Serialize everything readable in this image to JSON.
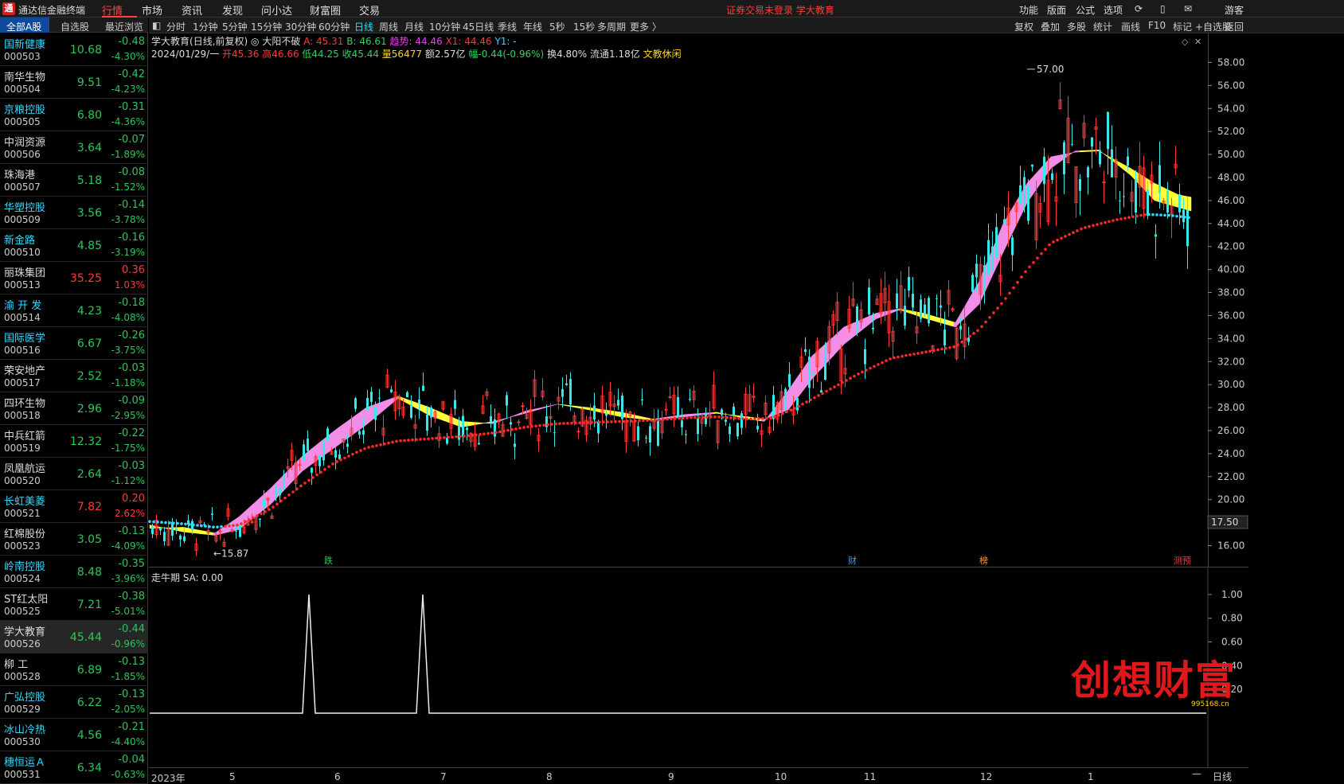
{
  "app": {
    "logo": "通",
    "title": "通达信金融终端",
    "menus": [
      "行情",
      "市场",
      "资讯",
      "发现",
      "问小达",
      "财富圈",
      "交易"
    ],
    "active_menu": "行情",
    "login_warning": "证券交易未登录  学大教育",
    "tools": [
      "功能",
      "版面",
      "公式",
      "选项"
    ],
    "guest": "游客"
  },
  "left_panel": {
    "tabs": [
      "全部A股",
      "自选股",
      "最近浏览"
    ],
    "stocks": [
      {
        "name": "国新健康",
        "code": "000503",
        "price": "10.68",
        "chg": "-0.48",
        "pct": "-4.30%",
        "dir": "down",
        "cyan": true
      },
      {
        "name": "南华生物",
        "code": "000504",
        "price": "9.51",
        "chg": "-0.42",
        "pct": "-4.23%",
        "dir": "down",
        "cyan": false
      },
      {
        "name": "京粮控股",
        "code": "000505",
        "price": "6.80",
        "chg": "-0.31",
        "pct": "-4.36%",
        "dir": "down",
        "cyan": true
      },
      {
        "name": "中润资源",
        "code": "000506",
        "price": "3.64",
        "chg": "-0.07",
        "pct": "-1.89%",
        "dir": "down",
        "cyan": false
      },
      {
        "name": "珠海港",
        "code": "000507",
        "price": "5.18",
        "chg": "-0.08",
        "pct": "-1.52%",
        "dir": "down",
        "cyan": false
      },
      {
        "name": "华塑控股",
        "code": "000509",
        "price": "3.56",
        "chg": "-0.14",
        "pct": "-3.78%",
        "dir": "down",
        "cyan": true
      },
      {
        "name": "新金路",
        "code": "000510",
        "price": "4.85",
        "chg": "-0.16",
        "pct": "-3.19%",
        "dir": "down",
        "cyan": true
      },
      {
        "name": "丽珠集团",
        "code": "000513",
        "price": "35.25",
        "chg": "0.36",
        "pct": "1.03%",
        "dir": "up",
        "cyan": false
      },
      {
        "name": "渝 开 发",
        "code": "000514",
        "price": "4.23",
        "chg": "-0.18",
        "pct": "-4.08%",
        "dir": "down",
        "cyan": true
      },
      {
        "name": "国际医学",
        "code": "000516",
        "price": "6.67",
        "chg": "-0.26",
        "pct": "-3.75%",
        "dir": "down",
        "cyan": true
      },
      {
        "name": "荣安地产",
        "code": "000517",
        "price": "2.52",
        "chg": "-0.03",
        "pct": "-1.18%",
        "dir": "down",
        "cyan": false
      },
      {
        "name": "四环生物",
        "code": "000518",
        "price": "2.96",
        "chg": "-0.09",
        "pct": "-2.95%",
        "dir": "down",
        "cyan": false
      },
      {
        "name": "中兵红箭",
        "code": "000519",
        "price": "12.32",
        "chg": "-0.22",
        "pct": "-1.75%",
        "dir": "down",
        "cyan": false
      },
      {
        "name": "凤凰航运",
        "code": "000520",
        "price": "2.64",
        "chg": "-0.03",
        "pct": "-1.12%",
        "dir": "down",
        "cyan": false
      },
      {
        "name": "长虹美菱",
        "code": "000521",
        "price": "7.82",
        "chg": "0.20",
        "pct": "2.62%",
        "dir": "up",
        "cyan": true
      },
      {
        "name": "红棉股份",
        "code": "000523",
        "price": "3.05",
        "chg": "-0.13",
        "pct": "-4.09%",
        "dir": "down",
        "cyan": false
      },
      {
        "name": "岭南控股",
        "code": "000524",
        "price": "8.48",
        "chg": "-0.35",
        "pct": "-3.96%",
        "dir": "down",
        "cyan": true
      },
      {
        "name": "ST红太阳",
        "code": "000525",
        "price": "7.21",
        "chg": "-0.38",
        "pct": "-5.01%",
        "dir": "down",
        "cyan": false
      },
      {
        "name": "学大教育",
        "code": "000526",
        "price": "45.44",
        "chg": "-0.44",
        "pct": "-0.96%",
        "dir": "down",
        "cyan": false,
        "selected": true
      },
      {
        "name": "柳 工",
        "code": "000528",
        "price": "6.89",
        "chg": "-0.13",
        "pct": "-1.85%",
        "dir": "down",
        "cyan": false
      },
      {
        "name": "广弘控股",
        "code": "000529",
        "price": "6.22",
        "chg": "-0.13",
        "pct": "-2.05%",
        "dir": "down",
        "cyan": true
      },
      {
        "name": "冰山冷热",
        "code": "000530",
        "price": "4.56",
        "chg": "-0.21",
        "pct": "-4.40%",
        "dir": "down",
        "cyan": true
      },
      {
        "name": "穗恒运Ａ",
        "code": "000531",
        "price": "6.34",
        "chg": "-0.04",
        "pct": "-0.63%",
        "dir": "down",
        "cyan": true
      }
    ]
  },
  "chart_toolbar": {
    "periods": [
      "分时",
      "1分钟",
      "5分钟",
      "15分钟",
      "30分钟",
      "60分钟",
      "日线",
      "周线",
      "月线",
      "10分钟",
      "45日线",
      "季线",
      "年线",
      "5秒",
      "15秒",
      "多周期",
      "更多 〉"
    ],
    "active_period": "日线",
    "right_tools": [
      "复权",
      "叠加",
      "多股",
      "统计",
      "画线",
      "F10",
      "标记",
      "+自选股",
      "返回"
    ]
  },
  "chart_info": {
    "name": "学大教育",
    "mode": "(日线,前复权)",
    "indicator": "大阳不破",
    "A": "A: 45.31",
    "B": "B: 46.61",
    "trend": "趋势: 44.46",
    "X1": "X1: 44.46",
    "Y1": "Y1: -",
    "date": "2024/01/29/一",
    "open": "开45.36",
    "high": "高46.66",
    "low": "低44.25",
    "close": "收45.44",
    "vol": "量56477",
    "amt": "额2.57亿",
    "amp": "幅-0.44(-0.96%)",
    "turnover": "换4.80%",
    "float": "流通1.18亿",
    "sector": "文教休闲"
  },
  "sub_chart": {
    "title": "走牛期  SA: 0.00"
  },
  "markers": {
    "high_label": "57.00",
    "low_label": "15.87",
    "current_price": "17.50",
    "events": [
      "跌",
      "财",
      "榜",
      "测预"
    ]
  },
  "date_axis": [
    "2023年",
    "5",
    "6",
    "7",
    "8",
    "9",
    "10",
    "11",
    "12",
    "1"
  ],
  "period_label": "日线",
  "scroll_minus": "—",
  "watermark": {
    "title": "创想财富",
    "url": "995168.cn"
  },
  "colors": {
    "up": "#ff3838",
    "down": "#2dc65a",
    "accent": "#36d8ff",
    "band_up": "#f28ee8",
    "band_down": "#ffff3a"
  },
  "chart_data": {
    "type": "candlestick",
    "price_axis": [
      58,
      56,
      54,
      52,
      50,
      48,
      46,
      44,
      42,
      40,
      38,
      36,
      34,
      32,
      30,
      28,
      26,
      24,
      22,
      20,
      18,
      16
    ],
    "ylim": [
      15,
      59
    ],
    "sub_axis": [
      1.0,
      0.8,
      0.6,
      0.4,
      0.2,
      0
    ],
    "sub_ylim": [
      0,
      1.1
    ],
    "sub_spikes": [
      {
        "x_month": 5.7,
        "value": 1.0
      },
      {
        "x_month": 6.8,
        "value": 1.0
      }
    ],
    "month_ticks": {
      "5": 291,
      "6": 424,
      "7": 557,
      "8": 691,
      "9": 843,
      "10": 978,
      "11": 1089,
      "12": 1235,
      "1": 1370
    },
    "band_points": [
      [
        188,
        17.5,
        17.8
      ],
      [
        230,
        17.6,
        17.2
      ],
      [
        270,
        17.1,
        16.9
      ],
      [
        300,
        18.5,
        17.4
      ],
      [
        340,
        21.0,
        19.6
      ],
      [
        380,
        23.8,
        22.5
      ],
      [
        420,
        26.0,
        24.5
      ],
      [
        460,
        28.0,
        26.5
      ],
      [
        500,
        29.0,
        28.8
      ],
      [
        540,
        28.0,
        27.3
      ],
      [
        580,
        26.8,
        26.3
      ],
      [
        620,
        26.6,
        26.8
      ],
      [
        660,
        27.7,
        27.5
      ],
      [
        700,
        28.3,
        28.3
      ],
      [
        740,
        28.0,
        27.8
      ],
      [
        780,
        27.6,
        27.2
      ],
      [
        820,
        27.0,
        26.9
      ],
      [
        860,
        27.4,
        27.2
      ],
      [
        900,
        27.6,
        27.5
      ],
      [
        940,
        27.0,
        27.2
      ],
      [
        960,
        26.8,
        27.0
      ],
      [
        990,
        29.5,
        27.8
      ],
      [
        1020,
        32.5,
        30.5
      ],
      [
        1060,
        35.0,
        33.5
      ],
      [
        1100,
        36.2,
        35.7
      ],
      [
        1130,
        36.6,
        36.5
      ],
      [
        1160,
        36.2,
        35.8
      ],
      [
        1200,
        35.4,
        35.0
      ],
      [
        1230,
        39.0,
        37.0
      ],
      [
        1260,
        44.0,
        41.5
      ],
      [
        1290,
        47.5,
        45.8
      ],
      [
        1320,
        49.8,
        48.8
      ],
      [
        1350,
        50.2,
        50.3
      ],
      [
        1380,
        50.3,
        50.4
      ],
      [
        1420,
        48.8,
        48.2
      ],
      [
        1450,
        47.5,
        46.0
      ],
      [
        1480,
        46.5,
        45.4
      ],
      [
        1495,
        46.3,
        45.1
      ]
    ],
    "dotted_ma": [
      [
        188,
        18.1
      ],
      [
        230,
        17.9
      ],
      [
        270,
        17.6
      ],
      [
        300,
        17.8
      ],
      [
        340,
        19.2
      ],
      [
        380,
        21.3
      ],
      [
        420,
        23.2
      ],
      [
        460,
        24.5
      ],
      [
        500,
        25.1
      ],
      [
        540,
        25.3
      ],
      [
        580,
        25.5
      ],
      [
        620,
        25.8
      ],
      [
        660,
        26.3
      ],
      [
        700,
        26.6
      ],
      [
        740,
        26.7
      ],
      [
        780,
        26.8
      ],
      [
        820,
        26.9
      ],
      [
        860,
        27.1
      ],
      [
        900,
        27.2
      ],
      [
        940,
        27.0
      ],
      [
        970,
        27.1
      ],
      [
        1000,
        28.0
      ],
      [
        1040,
        29.5
      ],
      [
        1080,
        31.0
      ],
      [
        1120,
        32.3
      ],
      [
        1160,
        32.8
      ],
      [
        1200,
        33.3
      ],
      [
        1230,
        34.8
      ],
      [
        1260,
        37.2
      ],
      [
        1290,
        40.0
      ],
      [
        1320,
        42.3
      ],
      [
        1360,
        43.6
      ],
      [
        1400,
        44.3
      ],
      [
        1440,
        44.8
      ],
      [
        1470,
        44.7
      ],
      [
        1495,
        44.5
      ]
    ],
    "candles_seed": 7,
    "high_point": {
      "x": 1290,
      "value": 57.0
    },
    "low_point": {
      "x": 268,
      "value": 15.87
    }
  }
}
